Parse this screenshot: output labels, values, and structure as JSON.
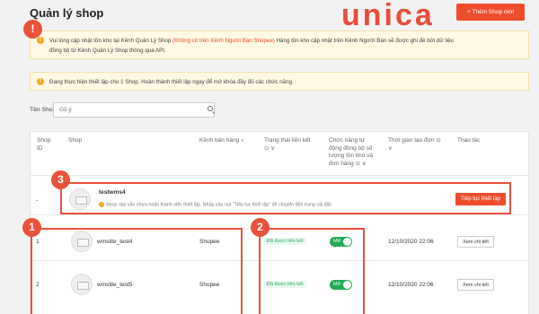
{
  "header": {
    "title": "Quản lý shop",
    "logo_text": "unica",
    "add_shop_label": "+ Thêm Shop mới"
  },
  "notice1": {
    "part1": "Vui lòng cập nhật tồn kho tại Kênh Quản Lý Shop ",
    "highlight": "(Không có trên Kênh Người Bán Shopee)",
    "part2": " Hàng tồn kho cập nhật trên Kênh Người Bán sẽ được ghi đè bởi dữ liệu",
    "line2": "đồng bộ từ Kênh Quản Lý Shop thông qua API."
  },
  "notice2": {
    "text": "Đang thực hiện thiết lập cho 1 Shop. Hoàn thành thiết lập ngay để mở khóa đầy đủ các chức năng."
  },
  "search": {
    "label": "Tên Shop",
    "placeholder": "Gõ ý"
  },
  "badges": {
    "b1": "1",
    "b2": "2",
    "b3": "3",
    "alert": "!"
  },
  "table": {
    "headers": {
      "shop_id_1": "Shop",
      "shop_id_2": "ID",
      "shop": "Shop",
      "channel": "Kênh bán hàng",
      "link_status_1": "Trạng thái liên kết",
      "link_status_2": "⊙ ∨",
      "sync_1": "Chức năng tự",
      "sync_2": "động đồng bộ số",
      "sync_3": "lượng tồn kho và",
      "sync_4": "đơn hàng ⊙ ∨",
      "created": "Thời gian tạo đơn ⊙",
      "created_2": "∨",
      "actions": "Thao tác"
    },
    "pending_row": {
      "id": "-",
      "name": "testwms4",
      "hint": "Shop này vẫn chưa hoàn thành việc thiết lập. Nhấp vào nút \"Tiếp tục thiết lập\" để chuyển đến trang cài đặt.",
      "button": "Tiếp tục thiết lập"
    },
    "rows": [
      {
        "id": "1",
        "name": "wmslite_test4",
        "channel": "Shopee",
        "status": "Đã được liên kết",
        "toggle": "Mở",
        "created": "12/10/2020 22:06",
        "action": "Xem chi tiết"
      },
      {
        "id": "2",
        "name": "wmslite_test5",
        "channel": "Shopee",
        "status": "Đã được liên kết",
        "toggle": "Mở",
        "created": "12/10/2020 22:06",
        "action": "Xem chi tiết"
      }
    ]
  }
}
